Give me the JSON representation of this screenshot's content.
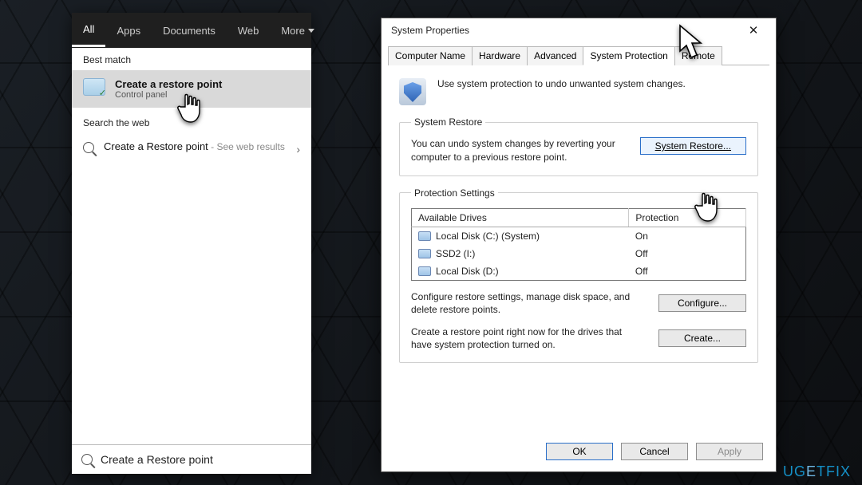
{
  "search": {
    "tabs": [
      "All",
      "Apps",
      "Documents",
      "Web",
      "More"
    ],
    "active_tab": "All",
    "best_match_label": "Best match",
    "best_match": {
      "title": "Create a restore point",
      "subtitle": "Control panel"
    },
    "search_web_label": "Search the web",
    "web_result": {
      "primary": "Create a Restore point",
      "suffix": " - See web results"
    },
    "input_value": "Create a Restore point"
  },
  "dialog": {
    "title": "System Properties",
    "tabs": [
      "Computer Name",
      "Hardware",
      "Advanced",
      "System Protection",
      "Remote"
    ],
    "active_tab": "System Protection",
    "intro": "Use system protection to undo unwanted system changes.",
    "system_restore": {
      "legend": "System Restore",
      "desc": "You can undo system changes by reverting your computer to a previous restore point.",
      "button": "System Restore..."
    },
    "protection": {
      "legend": "Protection Settings",
      "columns": [
        "Available Drives",
        "Protection"
      ],
      "drives": [
        {
          "name": "Local Disk (C:) (System)",
          "protection": "On"
        },
        {
          "name": "SSD2 (I:)",
          "protection": "Off"
        },
        {
          "name": "Local Disk (D:)",
          "protection": "Off"
        }
      ],
      "configure_desc": "Configure restore settings, manage disk space, and delete restore points.",
      "configure_button": "Configure...",
      "create_desc": "Create a restore point right now for the drives that have system protection turned on.",
      "create_button": "Create..."
    },
    "buttons": {
      "ok": "OK",
      "cancel": "Cancel",
      "apply": "Apply"
    }
  },
  "watermark": "UGETFIX"
}
